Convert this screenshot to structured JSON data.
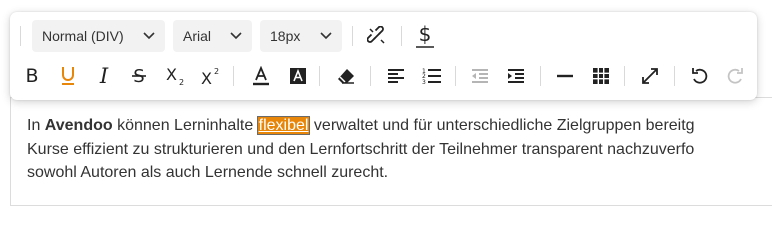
{
  "toolbar": {
    "block_format": "Normal (DIV)",
    "font_family": "Arial",
    "font_size": "18px",
    "icons": [
      "unlink-icon",
      "merge-field-dollar-icon",
      "bold-icon",
      "underline-icon",
      "italic-icon",
      "strikethrough-icon",
      "subscript-icon",
      "superscript-icon",
      "font-color-icon",
      "background-color-icon",
      "clear-formatting-icon",
      "align-left-icon",
      "ordered-list-icon",
      "outdent-icon",
      "indent-icon",
      "horizontal-line-icon",
      "table-icon",
      "fullscreen-icon",
      "undo-icon",
      "redo-icon"
    ],
    "colors": {
      "underline_accent": "#e8860a",
      "disabled": "#b5b5b5"
    }
  },
  "content": {
    "line1_pre": "In ",
    "line1_bold": "Avendoo",
    "line1_mid": " können Lerninhalte ",
    "line1_highlight": "flexibel",
    "line1_post": " verwaltet und für unterschiedliche Zielgruppen bereitg",
    "line2": "Kurse effizient zu strukturieren und den Lernfortschritt der Teilnehmer transparent nachzuverfo",
    "line3": "sowohl Autoren als auch Lernende schnell zurecht.",
    "highlight_color": "#e8860a"
  }
}
